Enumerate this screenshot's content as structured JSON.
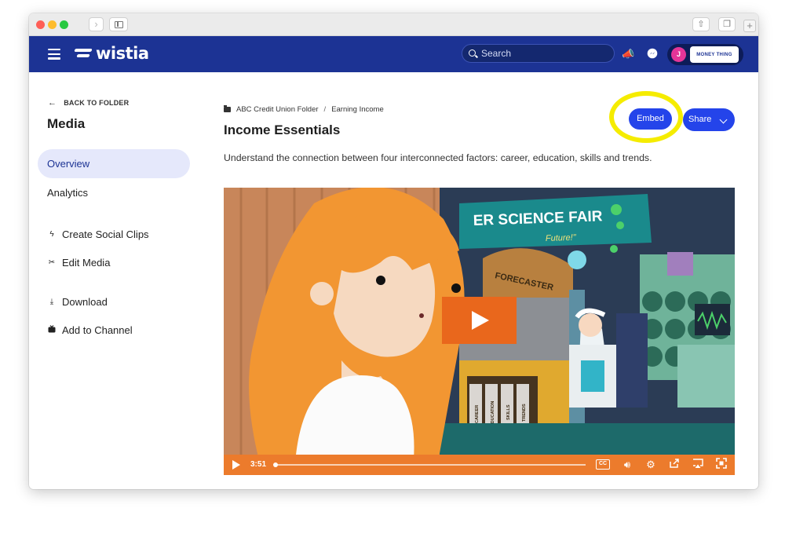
{
  "browser": {
    "back_icon": "chevron-left-icon",
    "forward_icon": "chevron-right-icon",
    "new_tab": "+"
  },
  "topbar": {
    "logo_text": "wistia",
    "search_placeholder": "Search",
    "avatar_initial": "J",
    "account_brand": "MONEY THING"
  },
  "sidebar": {
    "back_label": "BACK TO FOLDER",
    "title": "Media",
    "nav": [
      {
        "label": "Overview",
        "active": true
      },
      {
        "label": "Analytics",
        "active": false
      }
    ],
    "tools": [
      {
        "label": "Create Social Clips",
        "icon": "lightning-icon"
      },
      {
        "label": "Edit Media",
        "icon": "scissors-icon"
      },
      {
        "label": "Download",
        "icon": "download-icon"
      },
      {
        "label": "Add to Channel",
        "icon": "tv-icon"
      }
    ]
  },
  "main": {
    "breadcrumb": [
      "ABC Credit Union Folder",
      "Earning Income"
    ],
    "breadcrumb_sep": "/",
    "title": "Income Essentials",
    "description": "Understand the connection between four interconnected factors: career, education, skills and trends.",
    "embed_label": "Embed",
    "share_label": "Share"
  },
  "video": {
    "time": "3:51",
    "progress": 0.0,
    "cc_label": "CC",
    "sign_text": "ER SCIENCE FAIR",
    "sign_sub": "Future!\"",
    "booth_sign": "FORECASTER",
    "jar_labels": [
      "CAREER",
      "EDUCATION",
      "SKILLS",
      "TRENDS"
    ]
  },
  "colors": {
    "topbar": "#1c3394",
    "accent_button": "#2444ea",
    "active_nav_bg": "#e5e8fb",
    "player_controls": "#ec7b2c",
    "embed_highlight": "#f5ec00"
  }
}
